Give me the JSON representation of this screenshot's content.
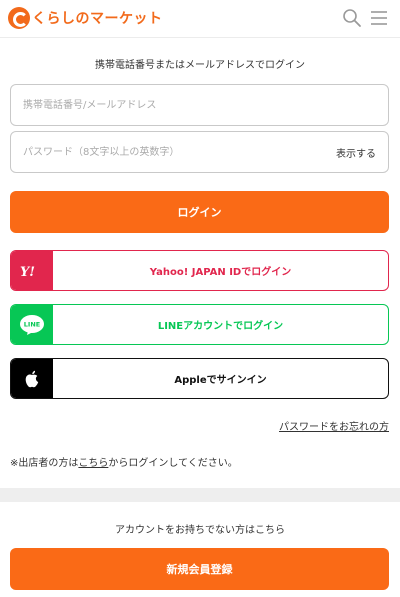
{
  "header": {
    "logo_text": "くらしのマーケット",
    "brand_color": "#f26a1b",
    "icons": [
      "search-icon",
      "menu-icon"
    ]
  },
  "login": {
    "lead": "携帯電話番号またはメールアドレスでログイン",
    "id_placeholder": "携帯電話番号/メールアドレス",
    "password_placeholder": "パスワード（8文字以上の英数字）",
    "show_password": "表示する",
    "login_button": "ログイン",
    "primary_color": "#fa6a16"
  },
  "social": {
    "yahoo": {
      "label": "Yahoo! JAPAN IDでログイン",
      "badge": "Y!",
      "color": "#e1264d"
    },
    "line": {
      "label": "LINEアカウントでログイン",
      "badge": "LINE",
      "color": "#07c755"
    },
    "apple": {
      "label": "Appleでサインイン",
      "color": "#000000"
    }
  },
  "links": {
    "forgot_password": "パスワードをお忘れの方",
    "store_prefix": "※出店者の方は",
    "store_link": "こちら",
    "store_suffix": "からログインしてください。"
  },
  "signup": {
    "lead": "アカウントをお持ちでない方はこちら",
    "register_button": "新規会員登録"
  }
}
